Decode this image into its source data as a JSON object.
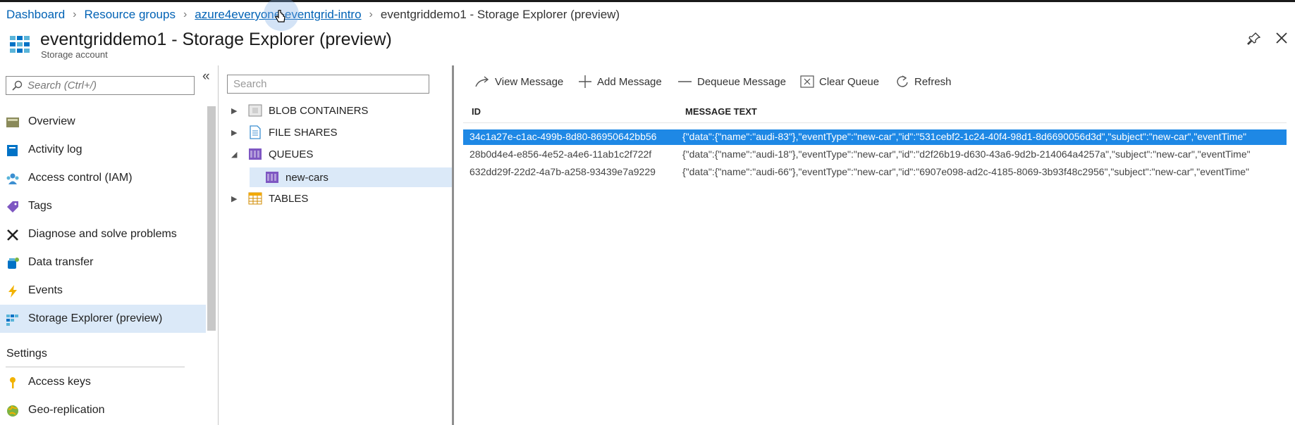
{
  "breadcrumb": {
    "items": [
      "Dashboard",
      "Resource groups",
      "azure4everyone-eventgrid-intro"
    ],
    "current": "eventgriddemo1 - Storage Explorer (preview)"
  },
  "header": {
    "title": "eventgriddemo1 - Storage Explorer (preview)",
    "subtitle": "Storage account"
  },
  "nav": {
    "search_placeholder": "Search (Ctrl+/)",
    "items": [
      {
        "label": "Overview",
        "icon": "overview-icon"
      },
      {
        "label": "Activity log",
        "icon": "activity-log-icon"
      },
      {
        "label": "Access control (IAM)",
        "icon": "iam-icon"
      },
      {
        "label": "Tags",
        "icon": "tag-icon"
      },
      {
        "label": "Diagnose and solve problems",
        "icon": "wrench-icon"
      },
      {
        "label": "Data transfer",
        "icon": "data-transfer-icon"
      },
      {
        "label": "Events",
        "icon": "lightning-icon"
      },
      {
        "label": "Storage Explorer (preview)",
        "icon": "storage-explorer-icon",
        "active": true
      }
    ],
    "section_settings": "Settings",
    "settings_items": [
      {
        "label": "Access keys",
        "icon": "key-icon"
      },
      {
        "label": "Geo-replication",
        "icon": "globe-icon"
      }
    ]
  },
  "tree": {
    "search_placeholder": "Search",
    "nodes": [
      {
        "label": "BLOB CONTAINERS",
        "icon": "blob-container-icon",
        "expanded": false
      },
      {
        "label": "FILE SHARES",
        "icon": "file-share-icon",
        "expanded": false
      },
      {
        "label": "QUEUES",
        "icon": "queue-icon",
        "expanded": true
      },
      {
        "label": "new-cars",
        "icon": "queue-icon",
        "child": true,
        "selected": true
      },
      {
        "label": "TABLES",
        "icon": "table-icon",
        "expanded": false
      }
    ]
  },
  "toolbar": {
    "view_message": "View Message",
    "add_message": "Add Message",
    "dequeue_message": "Dequeue Message",
    "clear_queue": "Clear Queue",
    "refresh": "Refresh"
  },
  "grid": {
    "columns": [
      "ID",
      "MESSAGE TEXT"
    ],
    "rows": [
      {
        "id": "34c1a27e-c1ac-499b-8d80-86950642bb56",
        "message": "{\"data\":{\"name\":\"audi-83\"},\"eventType\":\"new-car\",\"id\":\"531cebf2-1c24-40f4-98d1-8d6690056d3d\",\"subject\":\"new-car\",\"eventTime\"",
        "selected": true
      },
      {
        "id": "28b0d4e4-e856-4e52-a4e6-11ab1c2f722f",
        "message": "{\"data\":{\"name\":\"audi-18\"},\"eventType\":\"new-car\",\"id\":\"d2f26b19-d630-43a6-9d2b-214064a4257a\",\"subject\":\"new-car\",\"eventTime\""
      },
      {
        "id": "632dd29f-22d2-4a7b-a258-93439e7a9229",
        "message": "{\"data\":{\"name\":\"audi-66\"},\"eventType\":\"new-car\",\"id\":\"6907e098-ad2c-4185-8069-3b93f48c2956\",\"subject\":\"new-car\",\"eventTime\""
      }
    ]
  },
  "colors": {
    "accent": "#0062b5",
    "selection": "#1e88e5",
    "nav_active": "#dbe9f8"
  }
}
